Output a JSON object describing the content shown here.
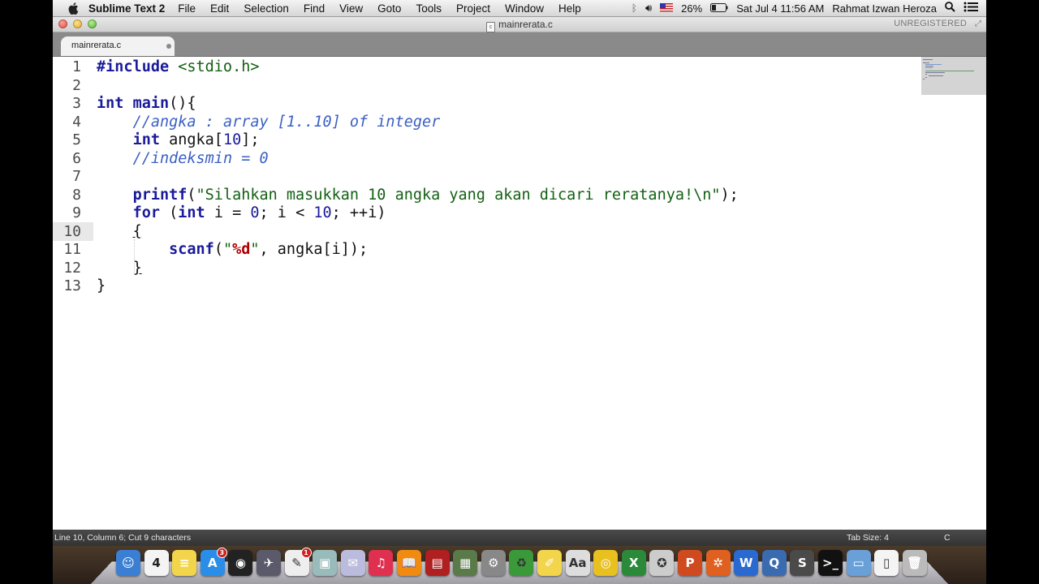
{
  "menubar": {
    "app_name": "Sublime Text 2",
    "items": [
      "File",
      "Edit",
      "Selection",
      "Find",
      "View",
      "Goto",
      "Tools",
      "Project",
      "Window",
      "Help"
    ],
    "battery": "26%",
    "datetime": "Sat Jul 4  11:56 AM",
    "user": "Rahmat Izwan Heroza"
  },
  "window": {
    "title": "mainrerata.c",
    "title_file_icon": "c",
    "license": "UNREGISTERED"
  },
  "tab": {
    "label": "mainrerata.c"
  },
  "editor": {
    "active_line": 10,
    "line_numbers": [
      "1",
      "2",
      "3",
      "4",
      "5",
      "6",
      "7",
      "8",
      "9",
      "10",
      "11",
      "12",
      "13"
    ],
    "lines": [
      [
        {
          "t": "#include",
          "c": "pp"
        },
        {
          "t": " <stdio.h>",
          "c": "str"
        }
      ],
      [],
      [
        {
          "t": "int",
          "c": "kw"
        },
        {
          "t": " "
        },
        {
          "t": "main",
          "c": "kw"
        },
        {
          "t": "(){"
        }
      ],
      [
        {
          "t": "    "
        },
        {
          "t": "//angka : array [1..10] of integer",
          "c": "cm"
        }
      ],
      [
        {
          "t": "    "
        },
        {
          "t": "int",
          "c": "kw"
        },
        {
          "t": " angka["
        },
        {
          "t": "10",
          "c": "num"
        },
        {
          "t": "];"
        }
      ],
      [
        {
          "t": "    "
        },
        {
          "t": "//indeksmin = 0",
          "c": "cm"
        }
      ],
      [],
      [
        {
          "t": "    "
        },
        {
          "t": "printf",
          "c": "kw"
        },
        {
          "t": "("
        },
        {
          "t": "\"Silahkan masukkan 10 angka yang akan dicari reratanya!",
          "c": "str"
        },
        {
          "t": "\\n",
          "c": "esc"
        },
        {
          "t": "\"",
          "c": "str"
        },
        {
          "t": ");"
        }
      ],
      [
        {
          "t": "    "
        },
        {
          "t": "for",
          "c": "kw"
        },
        {
          "t": " ("
        },
        {
          "t": "int",
          "c": "kw"
        },
        {
          "t": " i = "
        },
        {
          "t": "0",
          "c": "num"
        },
        {
          "t": "; i < "
        },
        {
          "t": "10",
          "c": "num"
        },
        {
          "t": "; ++i)"
        }
      ],
      [
        {
          "t": "    "
        },
        {
          "t": "{",
          "c": "brace-ul"
        }
      ],
      [
        {
          "t": "        "
        },
        {
          "t": "scanf",
          "c": "kw"
        },
        {
          "t": "("
        },
        {
          "t": "\"",
          "c": "str"
        },
        {
          "t": "%d",
          "c": "fmt"
        },
        {
          "t": "\"",
          "c": "str"
        },
        {
          "t": ", angka[i]);"
        }
      ],
      [
        {
          "t": "    "
        },
        {
          "t": "}",
          "c": "brace-ul"
        }
      ],
      [
        {
          "t": "}"
        }
      ]
    ]
  },
  "statusbar": {
    "position": "Line 10, Column 6; Cut 9 characters",
    "tab_size": "Tab Size: 4",
    "syntax": "C"
  },
  "dock": {
    "calendar_day": "4",
    "app_store_badge": "3",
    "notes_badge": "1",
    "apps": [
      {
        "name": "finder",
        "color": "#3b7fd4",
        "glyph": "☺"
      },
      {
        "name": "calendar",
        "color": "#f4f4f4",
        "glyph": ""
      },
      {
        "name": "notes",
        "color": "#f2d54a",
        "glyph": "≡"
      },
      {
        "name": "app-store",
        "color": "#2a8ee8",
        "glyph": "A"
      },
      {
        "name": "dashboard",
        "color": "#222",
        "glyph": "◉"
      },
      {
        "name": "launchpad",
        "color": "#5a5a6a",
        "glyph": "✈"
      },
      {
        "name": "textedit",
        "color": "#eee",
        "glyph": "✎"
      },
      {
        "name": "preview",
        "color": "#9bb",
        "glyph": "▣"
      },
      {
        "name": "mail",
        "color": "#bbd",
        "glyph": "✉"
      },
      {
        "name": "itunes",
        "color": "#e03050",
        "glyph": "♫"
      },
      {
        "name": "ibooks",
        "color": "#f08a10",
        "glyph": "📖"
      },
      {
        "name": "photo-booth",
        "color": "#b02020",
        "glyph": "▤"
      },
      {
        "name": "iphoto",
        "color": "#5a7a4a",
        "glyph": "▦"
      },
      {
        "name": "system-preferences",
        "color": "#888",
        "glyph": "⚙"
      },
      {
        "name": "utility",
        "color": "#3a9a3a",
        "glyph": "♻"
      },
      {
        "name": "stickies",
        "color": "#f2d54a",
        "glyph": "✐"
      },
      {
        "name": "dictionary",
        "color": "#ddd",
        "glyph": "Aa"
      },
      {
        "name": "chrome",
        "color": "#e8c020",
        "glyph": "◎"
      },
      {
        "name": "excel",
        "color": "#2a8a3a",
        "glyph": "X"
      },
      {
        "name": "safari",
        "color": "#ccc",
        "glyph": "✪"
      },
      {
        "name": "powerpoint",
        "color": "#d04a20",
        "glyph": "P"
      },
      {
        "name": "butterfly",
        "color": "#e06020",
        "glyph": "✲"
      },
      {
        "name": "word",
        "color": "#2a6ad0",
        "glyph": "W"
      },
      {
        "name": "quicktime",
        "color": "#3a6ab0",
        "glyph": "Q"
      },
      {
        "name": "sublime-text",
        "color": "#4a4a4a",
        "glyph": "S"
      },
      {
        "name": "terminal",
        "color": "#111",
        "glyph": ">_"
      },
      {
        "name": "folder",
        "color": "#6aa0d8",
        "glyph": "▭"
      },
      {
        "name": "document",
        "color": "#f4f4f4",
        "glyph": "▯"
      },
      {
        "name": "trash",
        "color": "#bbb",
        "glyph": "🗑"
      }
    ]
  }
}
